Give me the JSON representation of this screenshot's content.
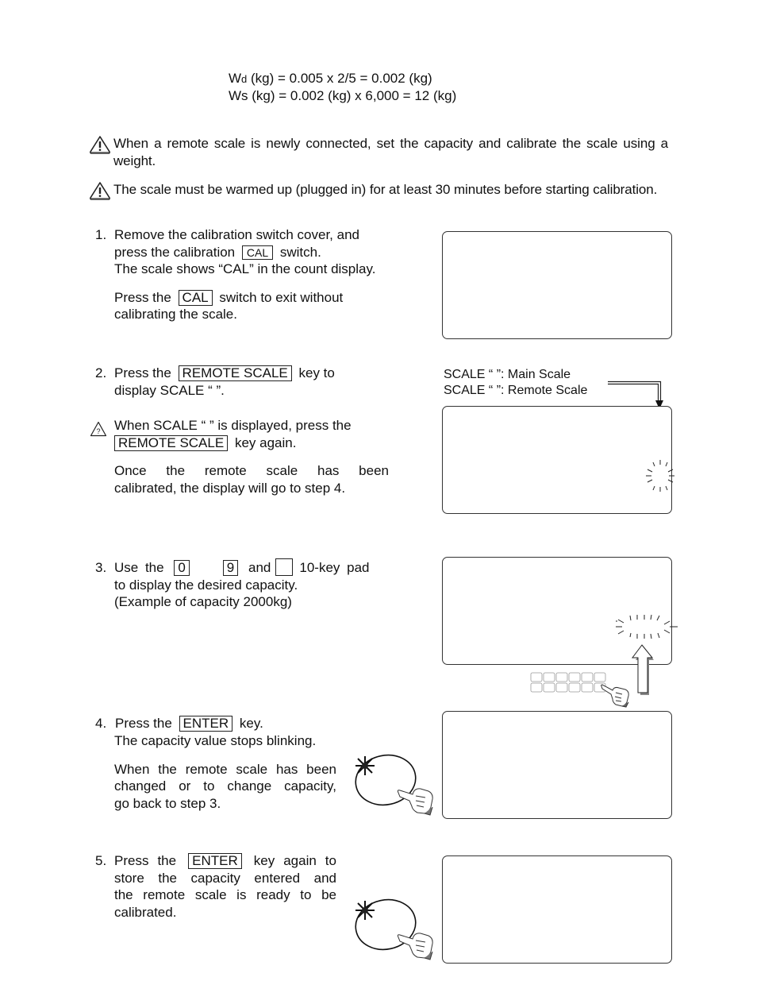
{
  "formulas": [
    {
      "prefix": "W",
      "sub": "d",
      "rest": " (kg) = 0.005 x 2/5 = 0.002 (kg)"
    },
    {
      "prefix": "W",
      "sub": "s",
      "rest": " (kg) = 0.002 (kg) x 6,000 = 12 (kg)"
    }
  ],
  "notes": [
    {
      "icon": "warning-triangle-icon",
      "text": "When a remote scale is newly connected, set the capacity and calibrate the scale using a weight."
    },
    {
      "icon": "warning-triangle-icon",
      "text": "The scale must be warmed up (plugged in) for at least 30 minutes before starting calibration."
    }
  ],
  "steps": {
    "s1": {
      "number": "1.",
      "line1": "Remove the calibration switch cover, and",
      "line2_pre": "press the calibration",
      "key": "CAL",
      "line2_post": "switch.",
      "line3": "The scale shows “CAL” in the count display.",
      "line4_pre": "Press the",
      "key2": "CAL",
      "line4_post": "switch to exit without",
      "line5": "calibrating the scale."
    },
    "s2": {
      "number": "2.",
      "line1_pre": "Press the",
      "key": "REMOTE SCALE",
      "line1_post": "key to",
      "line2": "display SCALE “   ”.",
      "note_icon": "caution-triangle-icon",
      "note_line1": "When SCALE “   ” is displayed, press the",
      "note_key": "REMOTE SCALE",
      "note_line2_post": "key again.",
      "para_line1": "Once the remote scale has been",
      "para_line2": "calibrated, the display will go to step 4.",
      "legend_main": "SCALE “   ”: Main Scale",
      "legend_remote": "SCALE “   ”: Remote Scale"
    },
    "s3": {
      "number": "3.",
      "line1_pre": "Use the",
      "key_from": "0",
      "key_to": "9",
      "and": "and",
      "key_blank": "",
      "line1_post": "10-key pad",
      "line2": "to display the desired capacity.",
      "line3": "(Example of capacity 2000kg)"
    },
    "s4": {
      "number": "4.",
      "line1_pre": "Press the",
      "key": "ENTER",
      "line1_post": "key.",
      "line2": "The capacity value stops blinking.",
      "para_line1": "When the remote scale has been",
      "para_line2": "changed or to change capacity,",
      "para_line3": "go back to step 3."
    },
    "s5": {
      "number": "5.",
      "line1_pre": "Press the",
      "key": "ENTER",
      "line1_post": "key again to",
      "line2": "store the capacity entered and",
      "line3": "the remote scale is ready to be",
      "line4": "calibrated."
    }
  },
  "colors": {
    "text": "#111111",
    "border": "#333333",
    "keypad_outline": "#999999"
  }
}
